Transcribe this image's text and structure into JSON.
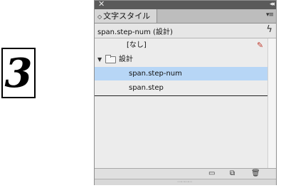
{
  "big_number": "3",
  "panel": {
    "close_glyph": "✕",
    "collapse_glyph": "◂◂",
    "tab_arrows": "◇",
    "tab_title": "文字スタイル",
    "menu_glyph": "▾≡",
    "current_style": "span.step-num (設計)",
    "lightning_glyph": "ϟ",
    "items": [
      {
        "label": "[なし]",
        "kind": "none"
      },
      {
        "label": "設計",
        "kind": "group"
      },
      {
        "label": "span.step-num",
        "kind": "style",
        "selected": true
      },
      {
        "label": "span.step",
        "kind": "style",
        "selected": false
      }
    ],
    "footer_icons": [
      "new-group-icon",
      "new-style-icon",
      "trash-icon"
    ],
    "grip_glyph": "⋯⋯⋯⋯"
  }
}
